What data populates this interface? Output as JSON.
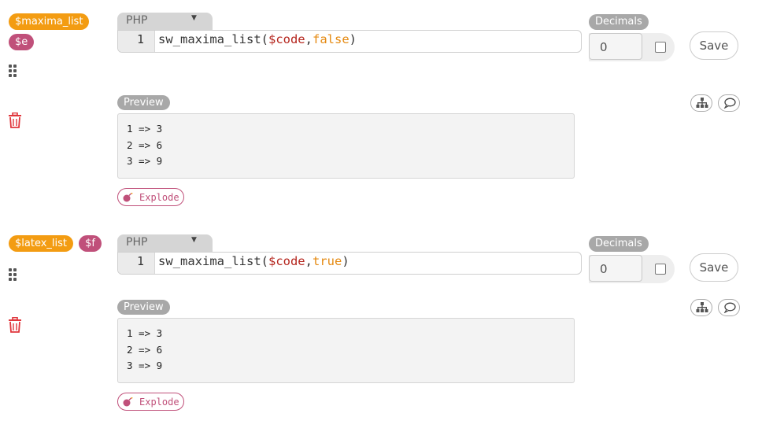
{
  "blocks": [
    {
      "variables": [
        {
          "label": "$maxima_list",
          "color": "#f39c12"
        },
        {
          "label": "$e",
          "color": "#c0507a"
        }
      ],
      "language": "PHP",
      "line_number": "1",
      "code": {
        "fn": "sw_maxima_list(",
        "var": "$code",
        "sep": ",",
        "arg": "false",
        "close": ")"
      },
      "decimals_label": "Decimals",
      "decimals_value": "0",
      "save_label": "Save",
      "preview_label": "Preview",
      "preview_lines": [
        "1 => 3",
        "2 => 6",
        "3 => 9"
      ],
      "explode_label": "Explode"
    },
    {
      "variables": [
        {
          "label": "$latex_list",
          "color": "#f39c12"
        },
        {
          "label": "$f",
          "color": "#c0507a"
        }
      ],
      "language": "PHP",
      "line_number": "1",
      "code": {
        "fn": "sw_maxima_list(",
        "var": "$code",
        "sep": ",",
        "arg": "true",
        "close": ")"
      },
      "decimals_label": "Decimals",
      "decimals_value": "0",
      "save_label": "Save",
      "preview_label": "Preview",
      "preview_lines": [
        "1 => 3",
        "2 => 6",
        "3 => 9"
      ],
      "explode_label": "Explode"
    }
  ],
  "colors": {
    "accent_orange": "#f39c12",
    "accent_pink": "#c0507a",
    "delete_red": "#e0363c"
  },
  "icons": [
    "drag-handle-icon",
    "trash-icon",
    "sitemap-icon",
    "comment-icon",
    "bomb-icon",
    "dropdown-caret-icon"
  ]
}
